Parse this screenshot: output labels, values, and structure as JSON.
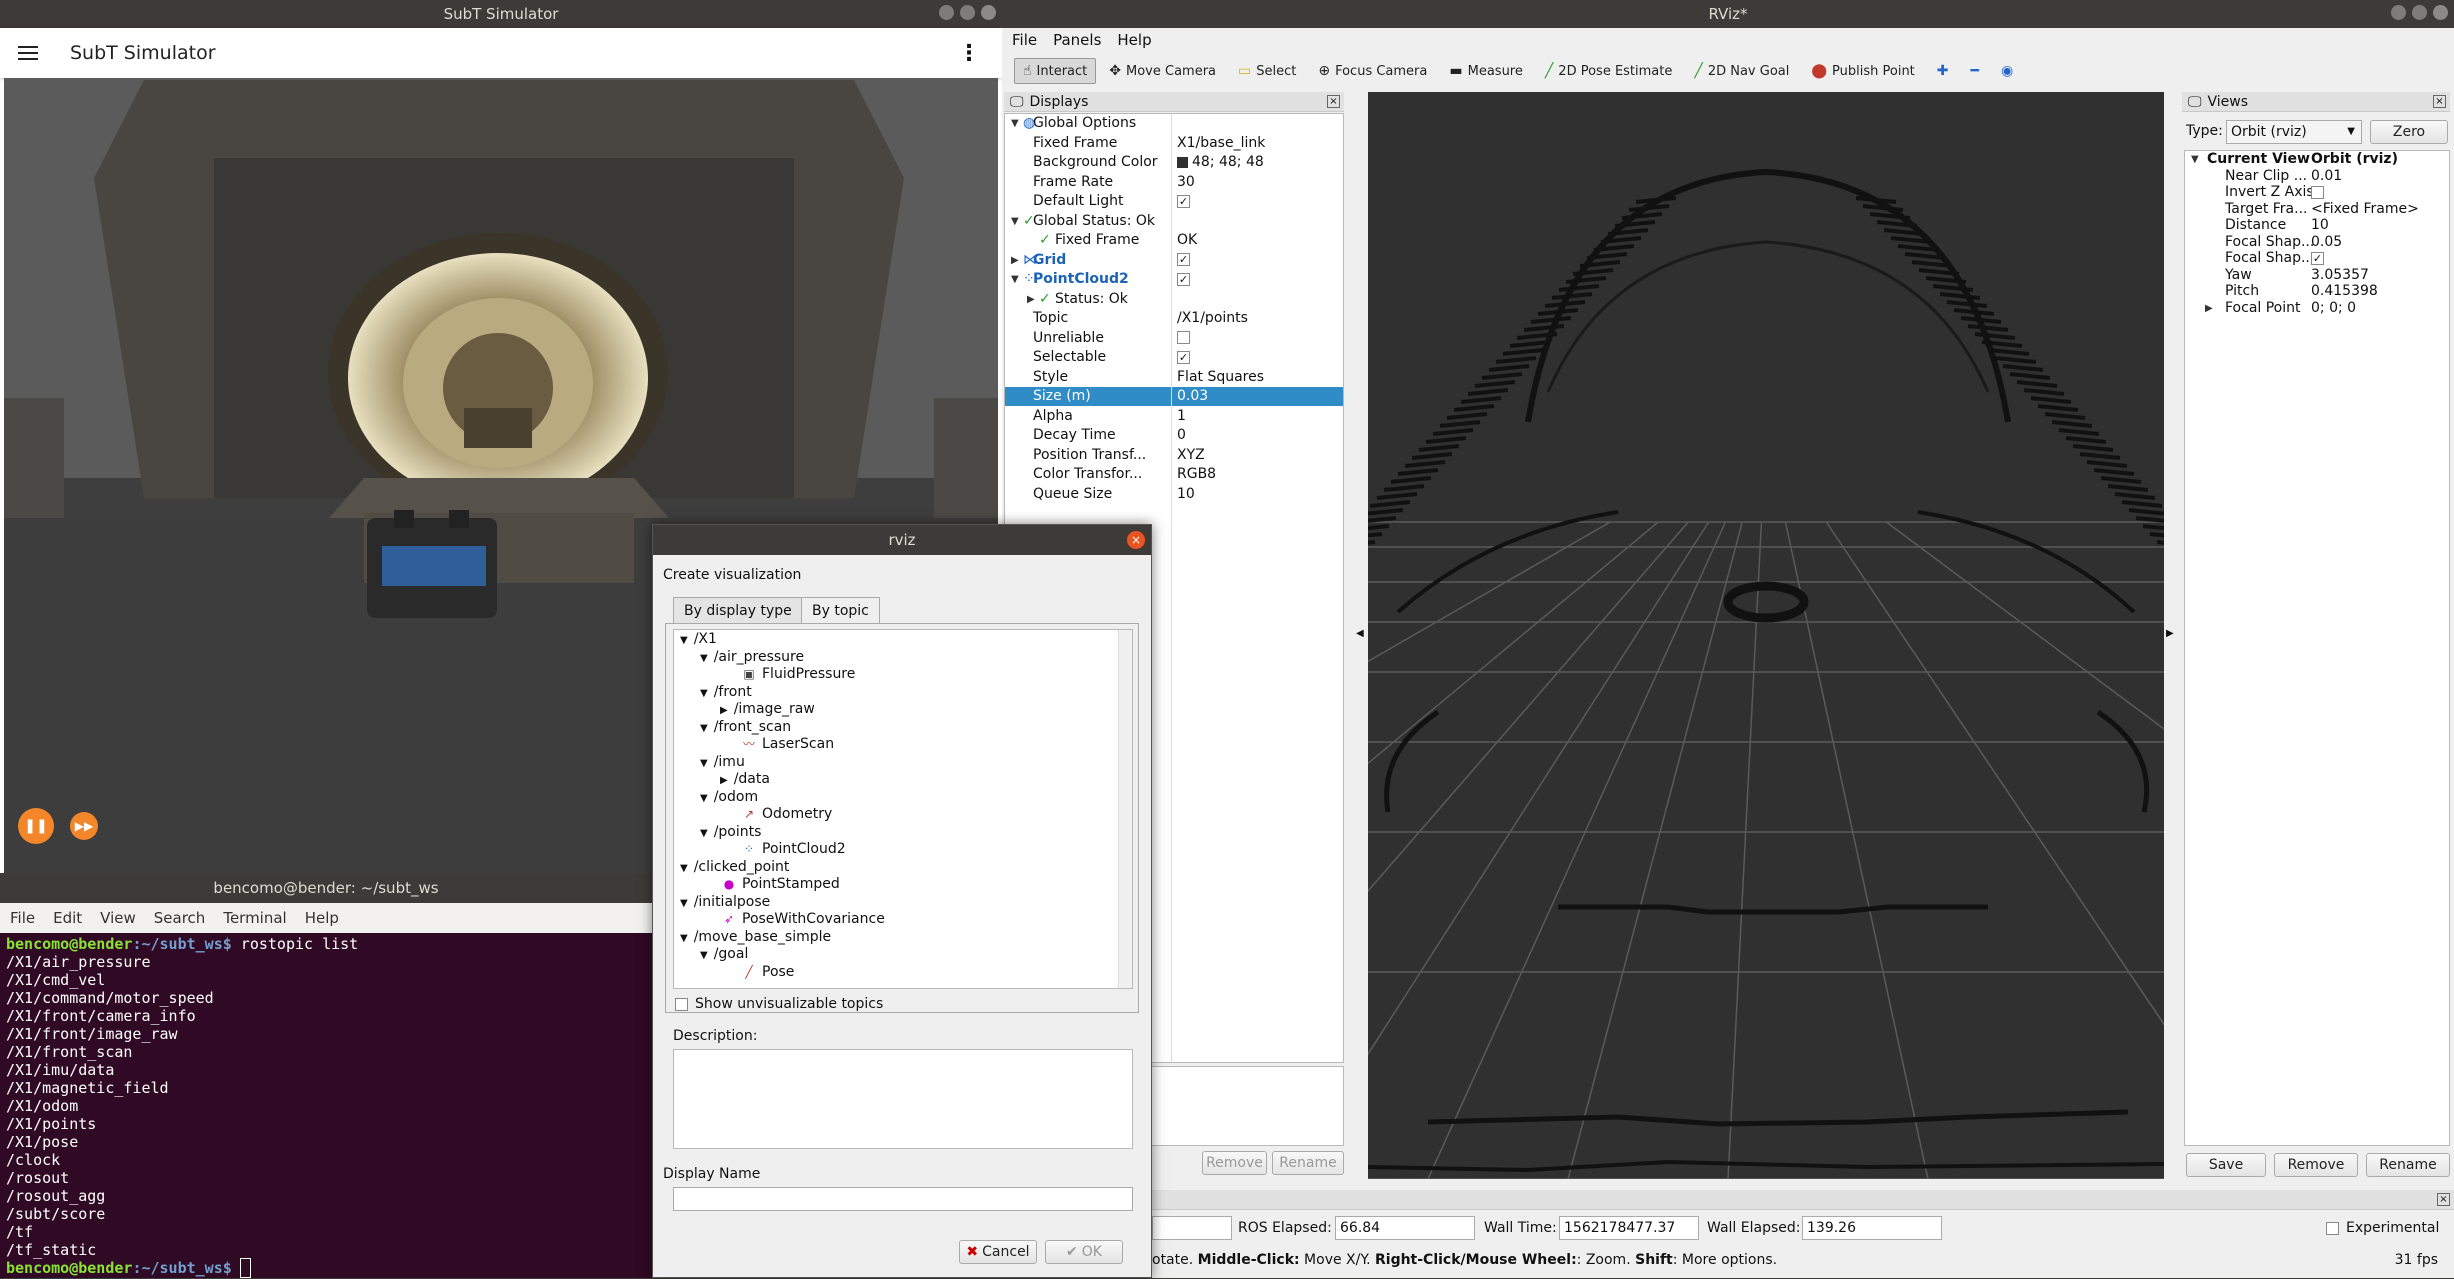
{
  "subt_window": {
    "title": "SubT Simulator",
    "app_title": "SubT Simulator"
  },
  "terminal": {
    "title": "bencomo@bender: ~/subt_ws",
    "menu": [
      "File",
      "Edit",
      "View",
      "Search",
      "Terminal",
      "Help"
    ],
    "prompt": "bencomo@bender",
    "path": ":~/subt_ws$",
    "command": " rostopic list",
    "output": [
      "/X1/air_pressure",
      "/X1/cmd_vel",
      "/X1/command/motor_speed",
      "/X1/front/camera_info",
      "/X1/front/image_raw",
      "/X1/front_scan",
      "/X1/imu/data",
      "/X1/magnetic_field",
      "/X1/odom",
      "/X1/points",
      "/X1/pose",
      "/clock",
      "/rosout",
      "/rosout_agg",
      "/subt/score",
      "/tf",
      "/tf_static"
    ]
  },
  "rviz": {
    "title": "RViz*",
    "menu": [
      "File",
      "Panels",
      "Help"
    ],
    "toolbar": [
      {
        "label": "Interact",
        "icon": "interact-icon"
      },
      {
        "label": "Move Camera",
        "icon": "move-camera-icon"
      },
      {
        "label": "Select",
        "icon": "select-icon"
      },
      {
        "label": "Focus Camera",
        "icon": "focus-camera-icon"
      },
      {
        "label": "Measure",
        "icon": "measure-icon"
      },
      {
        "label": "2D Pose Estimate",
        "icon": "pose-estimate-icon"
      },
      {
        "label": "2D Nav Goal",
        "icon": "nav-goal-icon"
      },
      {
        "label": "Publish Point",
        "icon": "publish-point-icon"
      }
    ],
    "displays": {
      "title": "Displays",
      "rows": [
        {
          "k": "Global Options",
          "v": ""
        },
        {
          "k": "Fixed Frame",
          "v": "X1/base_link"
        },
        {
          "k": "Background Color",
          "v": "48; 48; 48"
        },
        {
          "k": "Frame Rate",
          "v": "30"
        },
        {
          "k": "Default Light",
          "v": ""
        },
        {
          "k": "Global Status: Ok",
          "v": ""
        },
        {
          "k": "Fixed Frame",
          "v": "OK"
        },
        {
          "k": "Grid",
          "v": ""
        },
        {
          "k": "PointCloud2",
          "v": ""
        },
        {
          "k": "Status: Ok",
          "v": ""
        },
        {
          "k": "Topic",
          "v": "/X1/points"
        },
        {
          "k": "Unreliable",
          "v": ""
        },
        {
          "k": "Selectable",
          "v": ""
        },
        {
          "k": "Style",
          "v": "Flat Squares"
        },
        {
          "k": "Size (m)",
          "v": "0.03"
        },
        {
          "k": "Alpha",
          "v": "1"
        },
        {
          "k": "Decay Time",
          "v": "0"
        },
        {
          "k": "Position Transf...",
          "v": "XYZ"
        },
        {
          "k": "Color Transfor...",
          "v": "RGB8"
        },
        {
          "k": "Queue Size",
          "v": "10"
        }
      ],
      "buttons": [
        "Remove",
        "Rename"
      ]
    },
    "views": {
      "title": "Views",
      "type_label": "Type:",
      "type_value": "Orbit (rviz)",
      "zero": "Zero",
      "rows": [
        {
          "k": "Current View",
          "v": "Orbit (rviz)"
        },
        {
          "k": "Near Clip ...",
          "v": "0.01"
        },
        {
          "k": "Invert Z Axis",
          "v": ""
        },
        {
          "k": "Target Fra...",
          "v": "<Fixed Frame>"
        },
        {
          "k": "Distance",
          "v": "10"
        },
        {
          "k": "Focal Shap...",
          "v": "0.05"
        },
        {
          "k": "Focal Shap...",
          "v": ""
        },
        {
          "k": "Yaw",
          "v": "3.05357"
        },
        {
          "k": "Pitch",
          "v": "0.415398"
        },
        {
          "k": "Focal Point",
          "v": "0; 0; 0"
        }
      ],
      "buttons": [
        "Save",
        "Remove",
        "Rename"
      ]
    },
    "status": {
      "ros_elapsed_label": "ROS Elapsed:",
      "ros_elapsed": "66.84",
      "wall_time_label": "Wall Time:",
      "wall_time": "1562178477.37",
      "wall_elapsed_label": "Wall Elapsed:",
      "wall_elapsed": "139.26",
      "experimental": "Experimental",
      "hint_prefix": "otate. ",
      "hint_middle": "Middle-Click:",
      "hint_middle_text": " Move X/Y. ",
      "hint_right": "Right-Click/Mouse Wheel:",
      "hint_right_text": ": Zoom. ",
      "hint_shift": "Shift",
      "hint_shift_text": ": More options.",
      "fps": "31 fps"
    }
  },
  "dialog": {
    "title": "rviz",
    "heading": "Create visualization",
    "tabs": [
      "By display type",
      "By topic"
    ],
    "tree": [
      {
        "t": "/X1",
        "d": 0,
        "exp": true
      },
      {
        "t": "/air_pressure",
        "d": 1,
        "exp": true
      },
      {
        "t": "FluidPressure",
        "d": 2,
        "icon": "fluid-pressure-icon"
      },
      {
        "t": "/front",
        "d": 1,
        "exp": true
      },
      {
        "t": "/image_raw",
        "d": 2,
        "col": true
      },
      {
        "t": "/front_scan",
        "d": 1,
        "exp": true
      },
      {
        "t": "LaserScan",
        "d": 2,
        "icon": "laser-scan-icon"
      },
      {
        "t": "/imu",
        "d": 1,
        "exp": true
      },
      {
        "t": "/data",
        "d": 2,
        "col": true
      },
      {
        "t": "/odom",
        "d": 1,
        "exp": true
      },
      {
        "t": "Odometry",
        "d": 2,
        "icon": "odometry-icon"
      },
      {
        "t": "/points",
        "d": 1,
        "exp": true
      },
      {
        "t": "PointCloud2",
        "d": 2,
        "icon": "pointcloud-icon"
      },
      {
        "t": "/clicked_point",
        "d": 0,
        "exp": true
      },
      {
        "t": "PointStamped",
        "d": 1,
        "icon": "point-stamped-icon"
      },
      {
        "t": "/initialpose",
        "d": 0,
        "exp": true
      },
      {
        "t": "PoseWithCovariance",
        "d": 1,
        "icon": "pose-covariance-icon"
      },
      {
        "t": "/move_base_simple",
        "d": 0,
        "exp": true
      },
      {
        "t": "/goal",
        "d": 1,
        "exp": true
      },
      {
        "t": "Pose",
        "d": 2,
        "icon": "pose-icon"
      }
    ],
    "show_unvisualizable": "Show unvisualizable topics",
    "description_label": "Description:",
    "display_name_label": "Display Name",
    "cancel": "Cancel",
    "ok": "OK"
  }
}
